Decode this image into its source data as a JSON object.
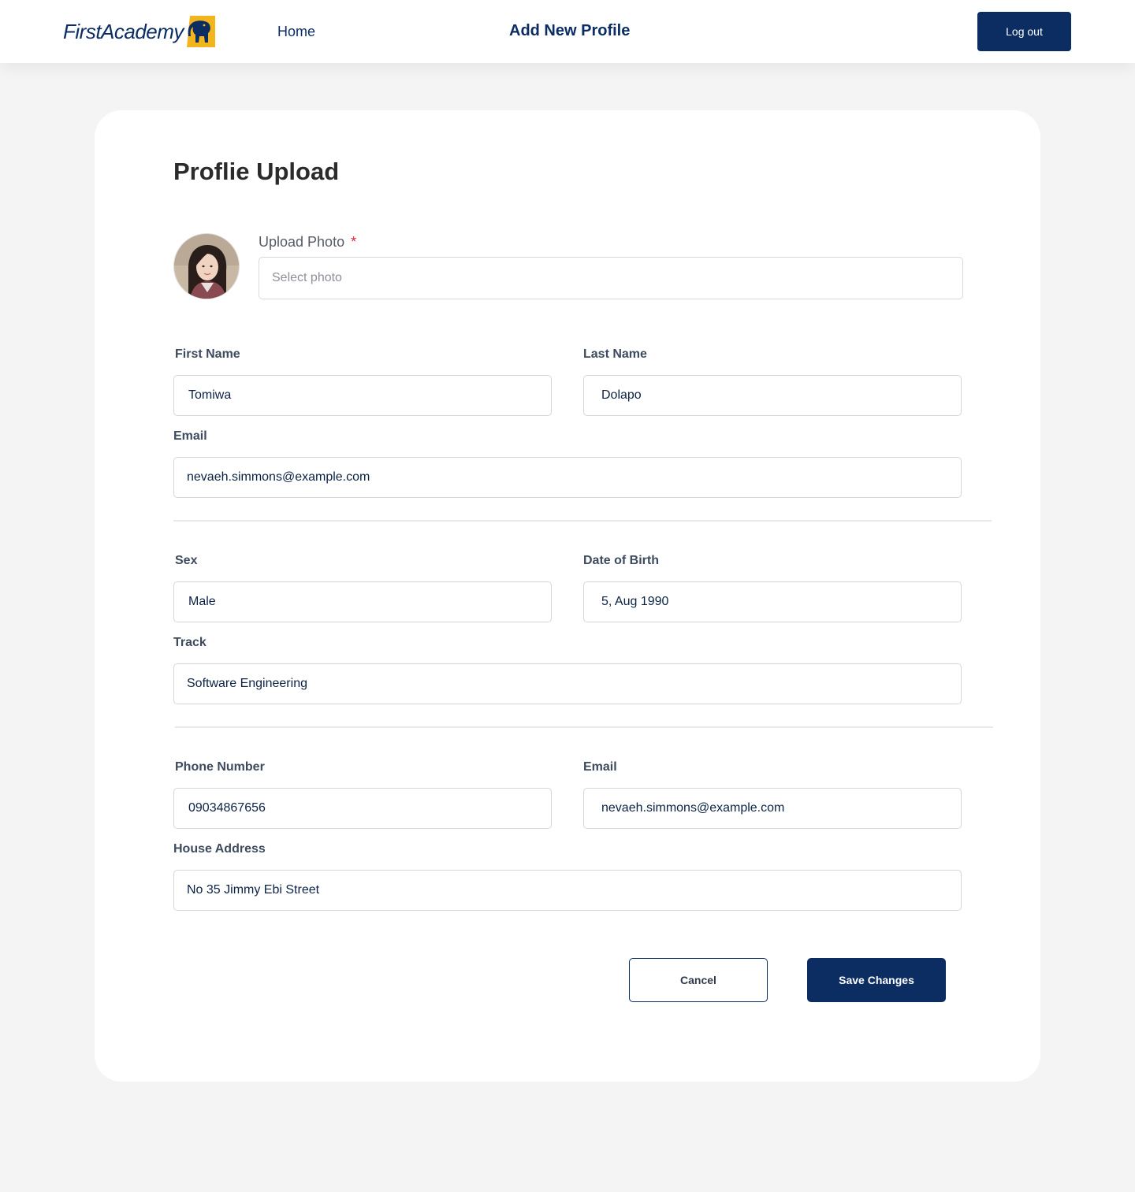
{
  "header": {
    "logo_text": "FirstAcademy",
    "home_link": "Home",
    "page_title": "Add New Profile",
    "logout_label": "Log out"
  },
  "form": {
    "title": "Proflie Upload",
    "upload": {
      "label": "Upload Photo",
      "required_mark": "*",
      "placeholder": "Select photo"
    },
    "first_name": {
      "label": "First Name",
      "value": "Tomiwa"
    },
    "last_name": {
      "label": "Last Name",
      "value": "Dolapo"
    },
    "email": {
      "label": "Email",
      "value": "nevaeh.simmons@example.com"
    },
    "sex": {
      "label": "Sex",
      "value": "Male"
    },
    "date_of_birth": {
      "label": "Date of Birth",
      "value": "5, Aug 1990"
    },
    "track": {
      "label": "Track",
      "value": "Software Engineering"
    },
    "phone": {
      "label": "Phone Number",
      "value": "09034867656"
    },
    "contact_email": {
      "label": "Email",
      "value": "nevaeh.simmons@example.com"
    },
    "address": {
      "label": "House Address",
      "value": "No 35 Jimmy Ebi Street"
    },
    "cancel_label": "Cancel",
    "save_label": "Save Changes"
  },
  "colors": {
    "brand_navy": "#0b2d62",
    "logo_yellow": "#f2b51d",
    "required_red": "#e0223a",
    "page_bg": "#f4f4f4"
  },
  "icons": {
    "logo_mark": "elephant-logo-icon",
    "avatar": "user-avatar-photo"
  }
}
